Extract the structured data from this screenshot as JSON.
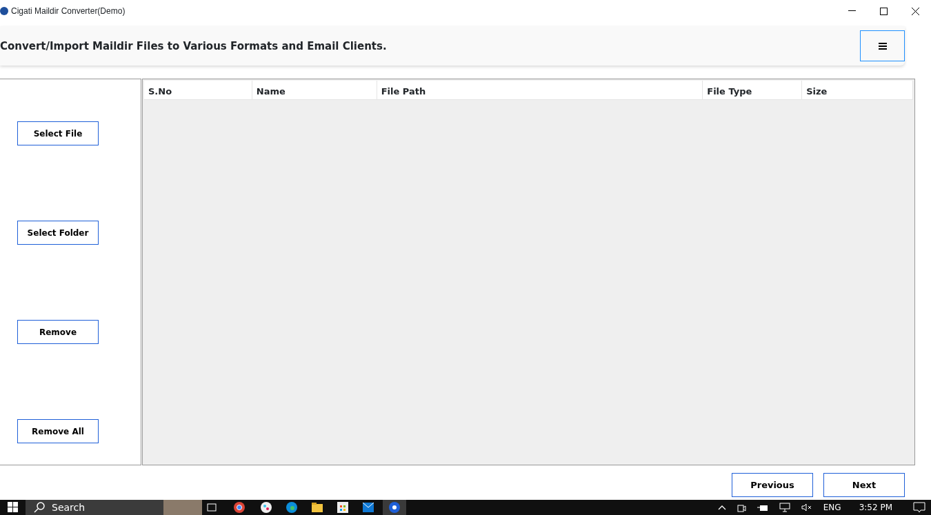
{
  "window": {
    "title": "Cigati Maildir Converter(Demo)"
  },
  "header": {
    "title": "Convert/Import Maildir Files to Various Formats and Email Clients."
  },
  "side_buttons": [
    "Select File",
    "Select Folder",
    "Remove",
    "Remove All"
  ],
  "table": {
    "columns": [
      "S.No",
      "Name",
      "File Path",
      "File Type",
      "Size"
    ]
  },
  "footer_buttons": [
    "Previous",
    "Next"
  ],
  "taskbar": {
    "search": "Search",
    "language": "ENG",
    "time": "3:52 PM"
  }
}
